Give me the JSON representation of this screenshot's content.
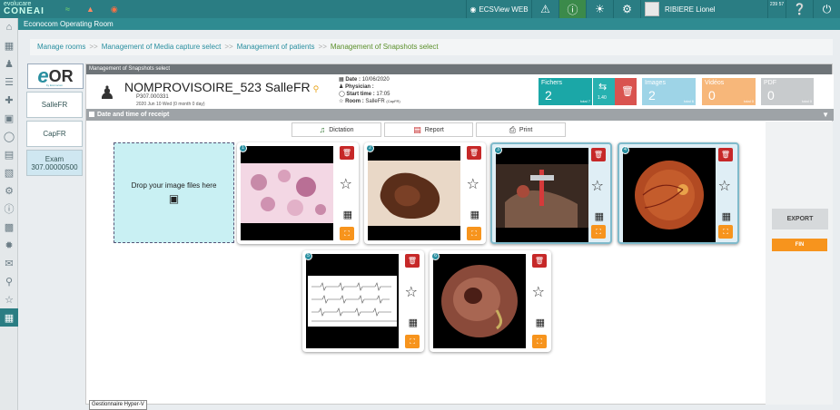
{
  "topbar": {
    "logo_top": "evolucare",
    "logo_bottom": "CONEAI",
    "ecsview": "ECSView WEB",
    "user": "RIBIERE Lionel",
    "time": "239 57",
    "icons": [
      "wifi-icon",
      "device-icon",
      "alarm-icon",
      "eye-icon",
      "warning-icon",
      "exclamation-icon",
      "sun-icon",
      "settings-icon",
      "help-icon",
      "power-icon"
    ]
  },
  "app_title": "Econocom Operating Room",
  "breadcrumb": {
    "items": [
      "Manage rooms",
      "Management of Media capture select",
      "Management of patients"
    ],
    "separator": ">>",
    "current": "Management of Snapshots select"
  },
  "sidebar": {
    "logo_e": "e",
    "logo_or": "OR",
    "logo_by": "by Econocom",
    "cards": [
      "SalleFR",
      "CapFR"
    ],
    "exam_label": "Exam",
    "exam_value": "307.00000500"
  },
  "panel": {
    "title": "Management of Snapshots select",
    "patient_name": "NOMPROVISOIRE_523 SalleFR",
    "patient_id": "P307.000331",
    "patient_dates": "2020 Jun 10 Wed (0 month 0 day)",
    "date_label": "Date :",
    "date_value": "10/06/2020",
    "physician_label": "Physician :",
    "physician_value": "",
    "start_label": "Start time :",
    "start_value": "17:05",
    "room_label": "Room :",
    "room_value": "SalleFR",
    "room_extra": "(CapFR)",
    "date_bar": "Date and time of receipt"
  },
  "tiles": {
    "fichiers": {
      "label": "Fichers",
      "num": "2",
      "total": "total 7",
      "color": "#1ba7a7"
    },
    "transfer": {
      "value": "1.40",
      "color": "#27b1b0"
    },
    "delete_color": "#d9534f",
    "images": {
      "label": "Images",
      "num": "2",
      "total": "total 6",
      "color": "#9ed4e7"
    },
    "videos": {
      "label": "Vidéos",
      "num": "0",
      "total": "total 0",
      "color": "#f7b77a"
    },
    "pdf": {
      "label": "PDF",
      "num": "0",
      "total": "total 0",
      "color": "#c8cbcd"
    }
  },
  "actions": {
    "dictation": "Dictation",
    "report": "Report",
    "print": "Print"
  },
  "dropzone": {
    "text": "Drop your image files here"
  },
  "cards": [
    {
      "num": "1",
      "selected": false
    },
    {
      "num": "2",
      "selected": false
    },
    {
      "num": "3",
      "selected": true
    },
    {
      "num": "4",
      "selected": true
    },
    {
      "num": "5",
      "selected": false
    },
    {
      "num": "6",
      "selected": false
    }
  ],
  "right": {
    "export": "EXPORT",
    "fin": "FIN"
  },
  "tooltip": "Gestionnaire Hyper-V"
}
